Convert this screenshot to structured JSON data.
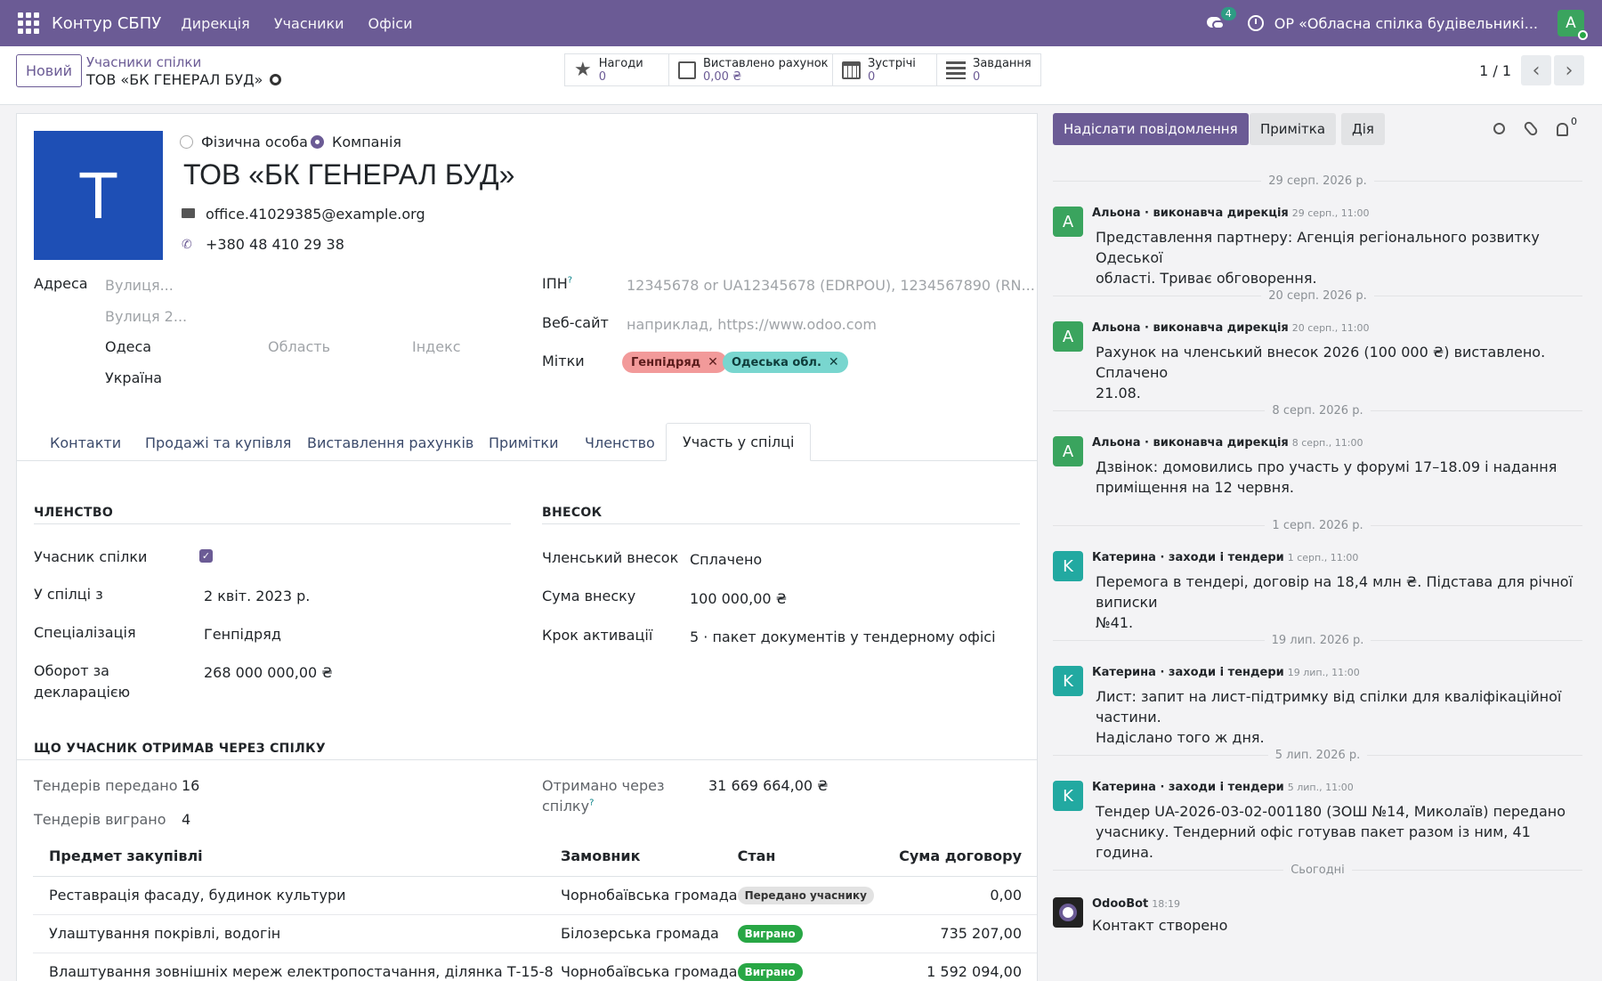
{
  "navbar": {
    "brand": "Контур СБПУ",
    "menus": [
      "Дирекція",
      "Учасники",
      "Офіси"
    ],
    "chat_count": "4",
    "company": "ОР «Обласна спілка будівельникі...",
    "user_initial": "A",
    "bg_color": "#6b5b95"
  },
  "control": {
    "new_label": "Новий",
    "breadcrumb_parent": "Учасники спілки",
    "breadcrumb_current": "ТОВ «БК ГЕНЕРАЛ БУД»",
    "smart_buttons": [
      {
        "icon": "star-icon",
        "label": "Нагоди",
        "value": "0"
      },
      {
        "icon": "invoice-icon",
        "label": "Виставлено рахунок",
        "value": "0,00 ₴"
      },
      {
        "icon": "calendar-icon",
        "label": "Зустрічі",
        "value": "0"
      },
      {
        "icon": "tasks-icon",
        "label": "Завдання",
        "value": "0"
      }
    ],
    "pager": "1 / 1"
  },
  "partner": {
    "avatar_letter": "T",
    "type_individual": "Фізична особа",
    "type_company": "Компанія",
    "name": "ТОВ «БК ГЕНЕРАЛ БУД»",
    "email": "office.41029385@example.org",
    "phone": "+380 48 410 29 38",
    "address_label": "Адреса",
    "street_ph": "Вулиця...",
    "street2_ph": "Вулиця 2...",
    "city": "Одеса",
    "state_ph": "Область",
    "zip_ph": "Індекс",
    "country": "Україна",
    "vat_label": "ІПН",
    "vat_help": "?",
    "vat_ph": "12345678 or UA12345678 (EDRPOU), 1234567890 (RN...",
    "website_label": "Веб-сайт",
    "website_ph": "наприклад, https://www.odoo.com",
    "tags_label": "Мітки",
    "tags": [
      {
        "name": "Генпідряд",
        "color": "#f29a9a"
      },
      {
        "name": "Одеська обл.",
        "color": "#79d6cf"
      }
    ]
  },
  "tabs": [
    "Контакти",
    "Продажі та купівля",
    "Виставлення рахунків",
    "Примітки",
    "Членство",
    "Участь у спілці"
  ],
  "membership": {
    "title": "ЧЛЕНСТВО",
    "member_label": "Учасник спілки",
    "since_label": "У спілці з",
    "since": "2 квіт. 2023 р.",
    "spec_label": "Спеціалізація",
    "spec": "Генпідряд",
    "turnover_label_1": "Оборот за",
    "turnover_label_2": "декларацією",
    "turnover": "268 000 000,00 ₴"
  },
  "fee": {
    "title": "ВНЕСОК",
    "fee_label": "Членський внесок",
    "fee": "Сплачено",
    "amount_label": "Сума внеску",
    "amount": "100 000,00 ₴",
    "step_label": "Крок активації",
    "step": "5 · пакет документів у тендерному офісі"
  },
  "received": {
    "title": "ЩО УЧАСНИК ОТРИМАВ ЧЕРЕЗ СПІЛКУ",
    "passed_label": "Тендерів передано",
    "passed": "16",
    "won_label": "Тендерів виграно",
    "won": "4",
    "via_label_1": "Отримано через",
    "via_label_2": "спілку",
    "via_help": "?",
    "via": "31 669 664,00 ₴",
    "columns": [
      "Предмет закупівлі",
      "Замовник",
      "Стан",
      "Сума договору"
    ],
    "rows": [
      {
        "subject": "Реставрація фасаду, будинок культури",
        "customer": "Чорнобаївська громада",
        "state": "Передано учаснику",
        "state_color": "grey",
        "amount": "0,00"
      },
      {
        "subject": "Улаштування покрівлі, водогін",
        "customer": "Білозерська громада",
        "state": "Виграно",
        "state_color": "green",
        "amount": "735 207,00"
      },
      {
        "subject": "Влаштування зовнішніх мереж електропостачання, ділянка Т-15-8",
        "customer": "Чорнобаївська громада",
        "state": "Виграно",
        "state_color": "green",
        "amount": "1 592 094,00"
      }
    ]
  },
  "chatter": {
    "send_label": "Надіслати повідомлення",
    "note_label": "Примітка",
    "action_label": "Дія",
    "followers": "0",
    "messages": [
      {
        "date": "29 серп. 2026 р.",
        "initial": "A",
        "color": "#3aa45e",
        "author": "Альона · виконавча дирекція",
        "time": "29 серп., 11:00",
        "line1": "Представлення партнеру: Агенція регіонального розвитку Одеської",
        "line2": "області. Триває обговорення."
      },
      {
        "date": "20 серп. 2026 р.",
        "initial": "A",
        "color": "#3aa45e",
        "author": "Альона · виконавча дирекція",
        "time": "20 серп., 11:00",
        "line1": "Рахунок на членський внесок 2026 (100 000 ₴) виставлено. Сплачено",
        "line2": "21.08."
      },
      {
        "date": "8 серп. 2026 р.",
        "initial": "A",
        "color": "#3aa45e",
        "author": "Альона · виконавча дирекція",
        "time": "8 серп., 11:00",
        "line1": "Дзвінок: домовились про участь у форумі 17–18.09 і надання",
        "line2": "приміщення на 12 червня."
      },
      {
        "date": "1 серп. 2026 р.",
        "initial": "K",
        "color": "#22a9a1",
        "author": "Катерина · заходи і тендери",
        "time": "1 серп., 11:00",
        "line1": "Перемога в тендері, договір на 18,4 млн ₴. Підстава для річної виписки",
        "line2": "№41."
      },
      {
        "date": "19 лип. 2026 р.",
        "initial": "K",
        "color": "#22a9a1",
        "author": "Катерина · заходи і тендери",
        "time": "19 лип., 11:00",
        "line1": "Лист: запит на лист-підтримку від спілки для кваліфікаційної частини.",
        "line2": "Надіслано того ж дня."
      },
      {
        "date": "5 лип. 2026 р.",
        "initial": "K",
        "color": "#22a9a1",
        "author": "Катерина · заходи і тендери",
        "time": "5 лип., 11:00",
        "line1": "Тендер UA-2026-03-02-001180 (ЗОШ №14, Миколаїв) передано",
        "line2": "учаснику. Тендерний офіс готував пакет разом із ним, 41 година."
      }
    ],
    "today_label": "Сьогодні",
    "bot_author": "OdooBot",
    "bot_time": "18:19",
    "bot_text": "Контакт створено"
  }
}
